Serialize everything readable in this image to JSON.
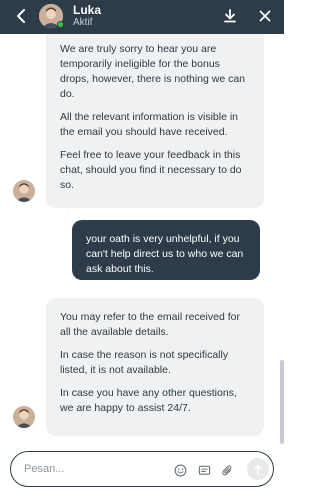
{
  "header": {
    "agent_name": "Luka",
    "agent_status": "Aktif",
    "back_icon": "chevron-left-icon",
    "download_icon": "download-icon",
    "close_icon": "close-icon"
  },
  "messages": [
    {
      "from": "agent",
      "paragraphs": [
        "We are truly sorry to hear you are temporarily ineligible for the bonus drops, however, there is nothing we can do.",
        "All the relevant information is visible in the email you should have received.",
        "Feel free to leave your feedback in this chat, should you find it necessary to do so."
      ]
    },
    {
      "from": "user",
      "paragraphs": [
        "your oath is very unhelpful, if you can't help direct us to who we can ask about this."
      ]
    },
    {
      "from": "agent",
      "paragraphs": [
        "You may refer to the email received for all the available details.",
        "In case the reason is not specifically listed, it is not available.",
        "In case you have any other questions, we are happy to assist 24/7."
      ]
    }
  ],
  "composer": {
    "placeholder": "Pesan...",
    "value": "",
    "emoji_icon": "emoji-icon",
    "template_icon": "message-template-icon",
    "attach_icon": "paperclip-icon",
    "send_icon": "send-arrow-icon"
  },
  "colors": {
    "header_bg": "#2d3c48",
    "agent_bubble_bg": "#f0f1f2",
    "user_bubble_bg": "#2d3c48",
    "online": "#2ecc40"
  }
}
